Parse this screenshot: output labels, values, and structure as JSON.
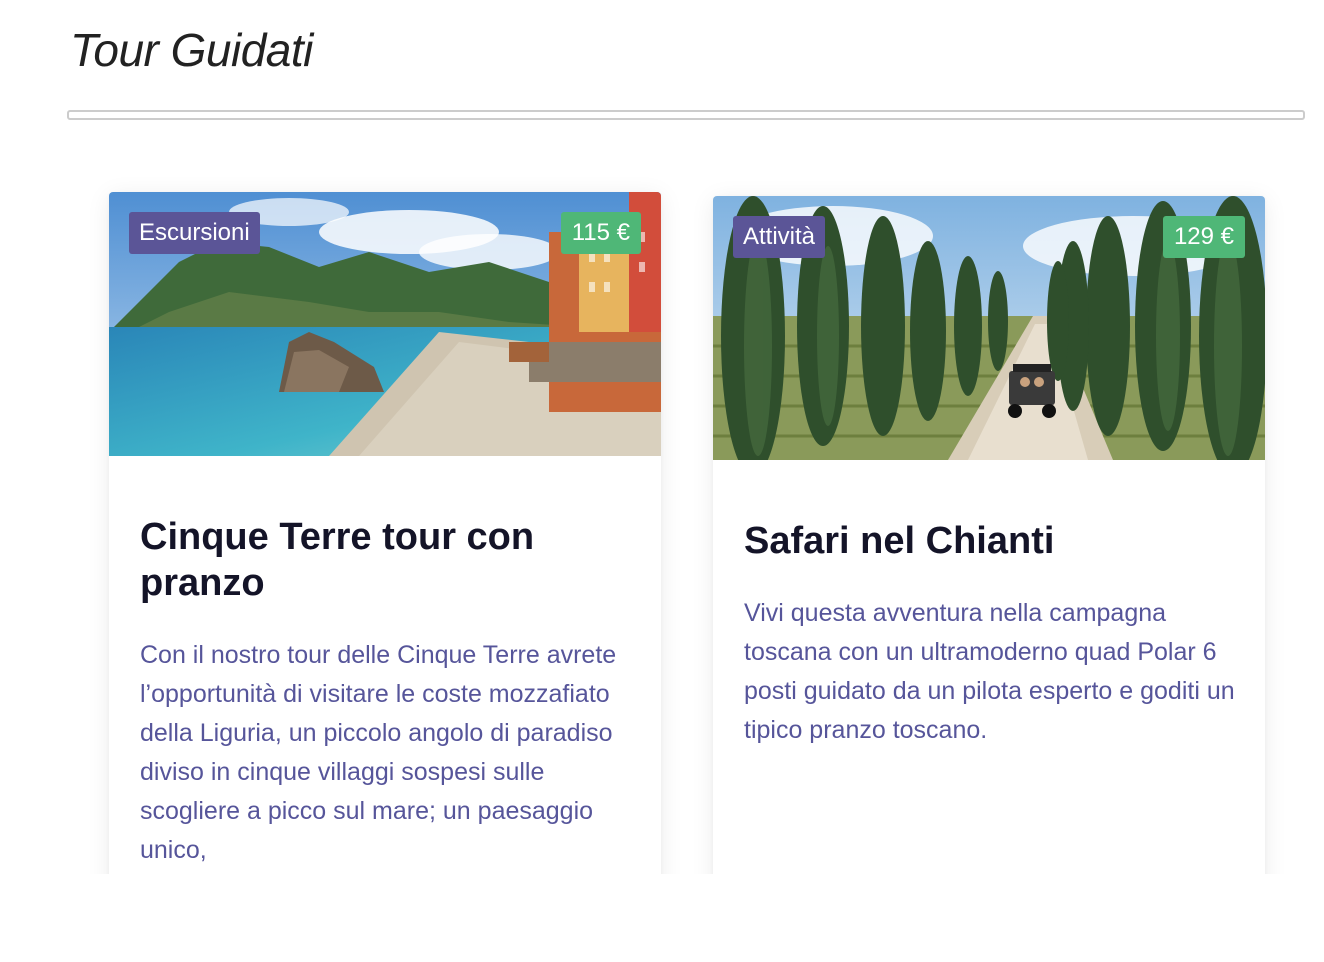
{
  "page": {
    "title": "Tour Guidati"
  },
  "cards": [
    {
      "category": "Escursioni",
      "price": "115 €",
      "title": "Cinque Terre tour con pranzo",
      "description": "Con il nostro tour delle Cinque Terre avrete l’opportunità di visitare le coste mozzafiato della Liguria, un piccolo angolo di paradiso diviso in cinque villaggi sospesi sulle scogliere a picco sul mare; un paesaggio unico,",
      "image": "coastal-village-beach-photo"
    },
    {
      "category": "Attività",
      "price": "129 €",
      "title": "Safari nel Chianti",
      "description": "Vivi questa avventura nella campagna toscana con un ultramoderno quad Polar 6 posti guidato da un pilota esperto e goditi un tipico pranzo toscano.",
      "image": "cypress-road-quad-photo"
    }
  ],
  "colors": {
    "category_badge": "#5b5597",
    "price_badge": "#4fb777",
    "title_text": "#141428",
    "body_text": "#56559a"
  }
}
